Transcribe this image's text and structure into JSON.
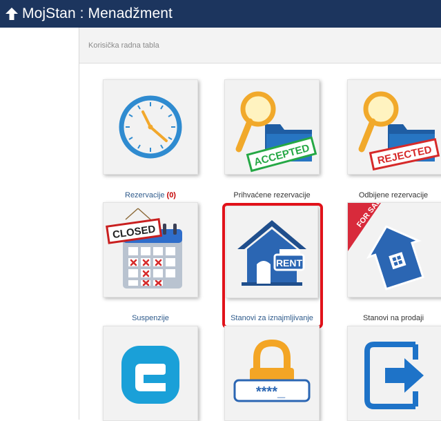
{
  "app": {
    "title": "MojStan : Menadžment"
  },
  "panel": {
    "header": "Korisička radna tabla"
  },
  "tiles": [
    {
      "label": "Rezervacije",
      "count": "(0)",
      "icon": "clock-icon"
    },
    {
      "label": "Prihvaćene rezervacije",
      "stamp": "ACCEPTED",
      "icon": "search-folder-accepted-icon"
    },
    {
      "label": "Odbijene rezervacije",
      "stamp": "REJECTED",
      "icon": "search-folder-rejected-icon"
    },
    {
      "label": "Suspenzije",
      "stamp": "CLOSED",
      "icon": "calendar-closed-icon"
    },
    {
      "label": "Stanovi za iznajmljivanje",
      "stamp": "RENT",
      "icon": "house-rent-icon",
      "highlighted": true
    },
    {
      "label": "Stanovi na prodaji",
      "stamp": "FOR SALE",
      "icon": "house-for-sale-icon"
    },
    {
      "icon": "e-logo-icon"
    },
    {
      "icon": "password-lock-icon"
    },
    {
      "icon": "logout-icon"
    }
  ],
  "colors": {
    "topbar": "#1c355e",
    "highlight": "#e1121a",
    "label": "#2e5a8b",
    "count": "#c40000"
  }
}
